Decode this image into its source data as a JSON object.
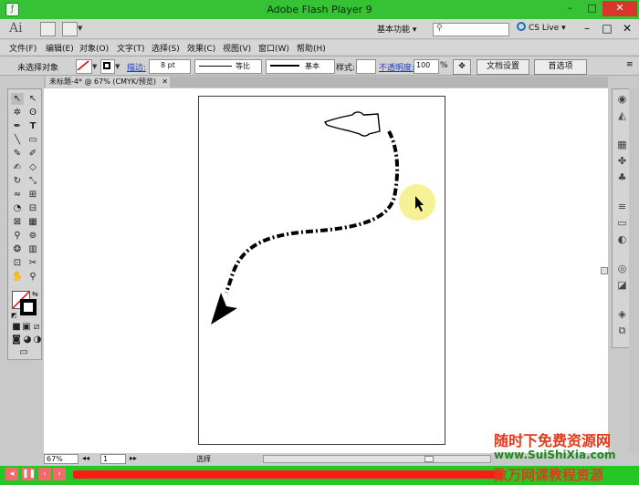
{
  "window": {
    "title": "Adobe Flash Player 9",
    "minimize": "–",
    "maximize": "□",
    "close": "✕"
  },
  "appbar": {
    "logo": "Ai",
    "workspace": "基本功能 ▾",
    "cslive": "CS Live ▾",
    "min": "–",
    "max": "□",
    "close": "✕"
  },
  "menu": [
    "文件(F)",
    "编辑(E)",
    "对象(O)",
    "文字(T)",
    "选择(S)",
    "效果(C)",
    "视图(V)",
    "窗口(W)",
    "帮助(H)"
  ],
  "control": {
    "selection": "未选择对象",
    "stroke_label": "描边:",
    "stroke_weight": "8 pt",
    "profile": "等比",
    "brush": "基本",
    "style_label": "样式:",
    "opacity_label": "不透明度:",
    "opacity": "100",
    "opacity_unit": "%",
    "doc_setup": "文档设置",
    "prefs": "首选项"
  },
  "tab": {
    "label": "未标题-4* @ 67% (CMYK/预览)",
    "close": "✕"
  },
  "status": {
    "zoom": "67%",
    "artboard": "1",
    "tool": "选择"
  },
  "watermark": {
    "line1": "随时下免费资源网",
    "line2": "www.SuiShiXia.com",
    "line3": "数万网课教程资源"
  },
  "colors": {
    "title_green": "#35c235",
    "player_green": "#25c725",
    "progress_red": "#ff1a1a"
  }
}
